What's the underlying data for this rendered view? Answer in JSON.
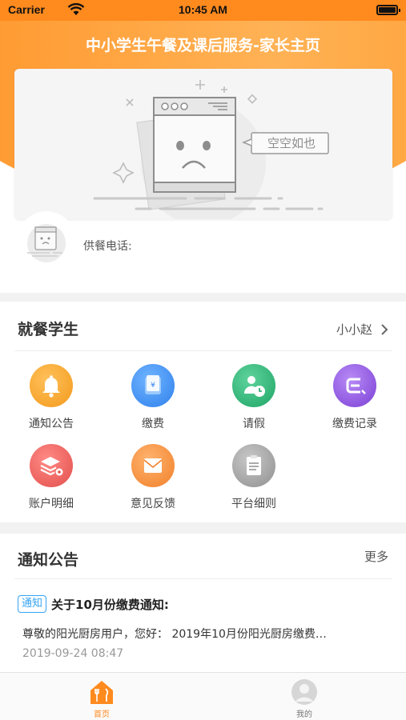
{
  "status_bar": {
    "carrier": "Carrier",
    "time": "10:45 AM"
  },
  "header": {
    "title": "中小学生午餐及课后服务-家长主页",
    "empty_text": "空空如也",
    "supply_phone_label": "供餐电话:"
  },
  "students": {
    "title": "就餐学生",
    "selected_student": "小小赵",
    "items": [
      {
        "label": "通知公告",
        "icon": "bell-icon",
        "color": "#f9a52c"
      },
      {
        "label": "缴费",
        "icon": "wallet-icon",
        "color": "#3d8ff5"
      },
      {
        "label": "请假",
        "icon": "leave-clock-icon",
        "color": "#2fb57a"
      },
      {
        "label": "缴费记录",
        "icon": "record-icon",
        "color": "#8a4fe0"
      },
      {
        "label": "账户明细",
        "icon": "layers-gear-icon",
        "color": "#ee5d5a"
      },
      {
        "label": "意见反馈",
        "icon": "envelope-icon",
        "color": "#f7933a"
      },
      {
        "label": "平台细则",
        "icon": "clipboard-icon",
        "color": "#9b9b9b"
      }
    ]
  },
  "notices": {
    "title": "通知公告",
    "more_label": "更多",
    "items": [
      {
        "tag": "通知",
        "title": "关于10月份缴费通知:",
        "body": "尊敬的阳光厨房用户，您好： 2019年10月份阳光厨房缴费…",
        "date": "2019-09-24 08:47"
      }
    ]
  },
  "tabbar": {
    "tabs": [
      {
        "label": "首页",
        "icon": "home-icon",
        "active": true
      },
      {
        "label": "我的",
        "icon": "user-icon",
        "active": false
      }
    ],
    "active_color": "#ff8a1e"
  }
}
